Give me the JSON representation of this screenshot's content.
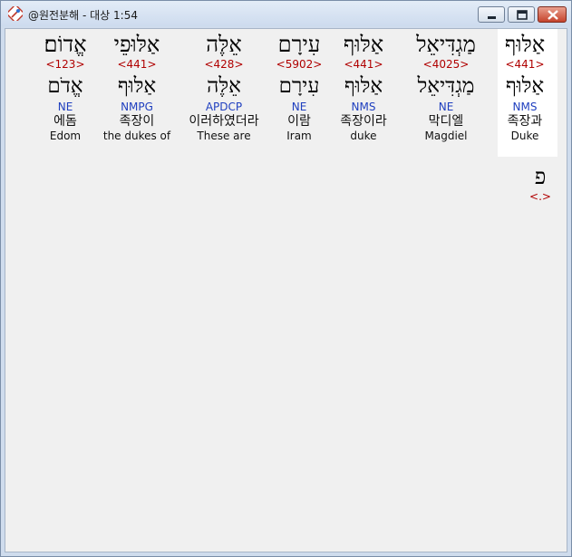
{
  "window": {
    "title": "@원전분해 - 대상 1:54"
  },
  "words": [
    {
      "hebrew": "אַלּוּף",
      "strong": "<441>",
      "lemma": "אַלּוּף",
      "morph": "NMS",
      "korean": "족장과",
      "english": "Duke",
      "selected": true
    },
    {
      "hebrew": "מַגְדִּיאֵל",
      "strong": "<4025>",
      "lemma": "מַגְדִּיאֵל",
      "morph": "NE",
      "korean": "막디엘",
      "english": "Magdiel",
      "selected": false
    },
    {
      "hebrew": "אַלּוּף",
      "strong": "<441>",
      "lemma": "אַלּוּף",
      "morph": "NMS",
      "korean": "족장이라",
      "english": "duke",
      "selected": false
    },
    {
      "hebrew": "עִירָם",
      "strong": "<5902>",
      "lemma": "עִירָם",
      "morph": "NE",
      "korean": "이람",
      "english": "Iram",
      "selected": false
    },
    {
      "hebrew": "אֵלֶּה",
      "strong": "<428>",
      "lemma": "אֵלֶּה",
      "morph": "APDCP",
      "korean": "이러하였더라",
      "english": "These are",
      "selected": false
    },
    {
      "hebrew": "אַלּוּפֵי",
      "strong": "<441>",
      "lemma": "אַלּוּף",
      "morph": "NMPG",
      "korean": "족장이",
      "english": "the dukes of",
      "selected": false
    },
    {
      "hebrew": "אֱדוֹם׃",
      "strong": "<123>",
      "lemma": "אֱדֹם",
      "morph": "NE",
      "korean": "에돔",
      "english": "Edom",
      "selected": false
    }
  ],
  "punctuation": {
    "hebrew": "פ",
    "strong": "<.>"
  }
}
